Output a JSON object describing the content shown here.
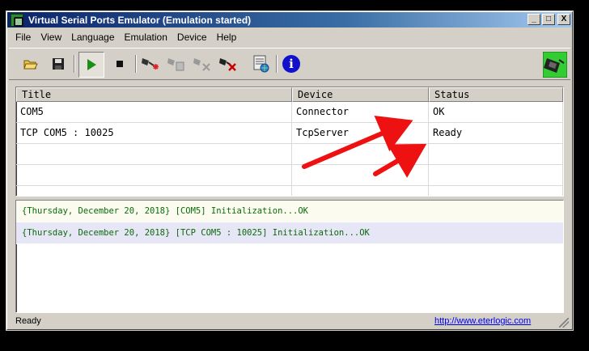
{
  "window": {
    "title": "Virtual Serial Ports Emulator (Emulation started)"
  },
  "caption_buttons": {
    "minimize": "_",
    "maximize": "□",
    "close": "X"
  },
  "menu": [
    "File",
    "View",
    "Language",
    "Emulation",
    "Device",
    "Help"
  ],
  "toolbar": {
    "icons": [
      "open-icon",
      "save-icon",
      "start-icon",
      "stop-icon",
      "create-device-icon",
      "edit-device-icon",
      "disable-device-icon",
      "delete-device-icon",
      "device-list-icon",
      "about-icon",
      "logo-icon"
    ],
    "about_glyph": "i",
    "colors": {
      "start": "#1a8f1a",
      "about": "#1111cc",
      "delete": "#cc0000"
    }
  },
  "grid": {
    "headers": [
      "Title",
      "Device",
      "Status"
    ],
    "rows": [
      [
        "COM5",
        "Connector",
        "OK"
      ],
      [
        "TCP COM5 : 10025",
        "TcpServer",
        "Ready"
      ],
      [
        "",
        "",
        ""
      ],
      [
        "",
        "",
        ""
      ],
      [
        "",
        "",
        ""
      ]
    ]
  },
  "log": [
    "{Thursday, December 20, 2018} [COM5] Initialization...OK",
    "{Thursday, December 20, 2018} [TCP COM5 : 10025] Initialization...OK"
  ],
  "status": {
    "text": "Ready",
    "link": "http://www.eterlogic.com"
  },
  "annotation_color": "#ee1111"
}
